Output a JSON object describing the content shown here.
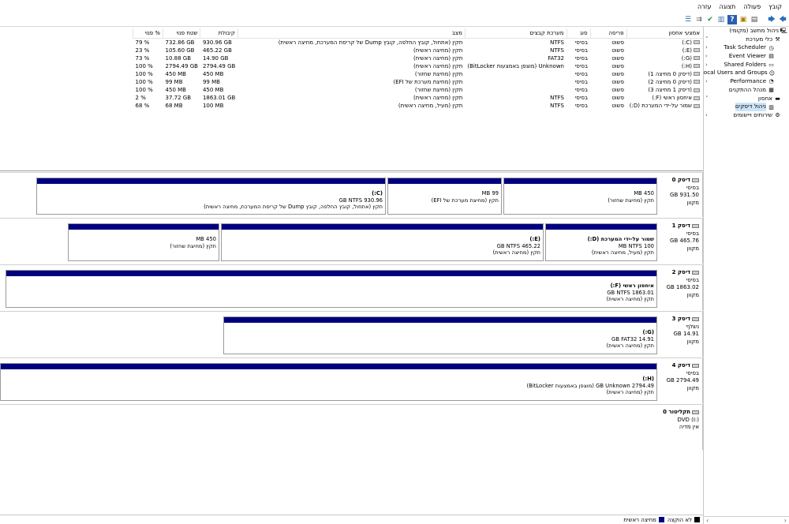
{
  "menu": [
    "קובץ",
    "פעולה",
    "תצוגה",
    "עזרה"
  ],
  "tree": [
    {
      "label": "ניהול מחשב (מקומי)",
      "icon": "computer-icon",
      "indent": 0,
      "chev": ""
    },
    {
      "label": "כלי מערכת",
      "icon": "tools-icon",
      "indent": 1,
      "chev": "˅"
    },
    {
      "label": "Task Scheduler",
      "icon": "clock-icon",
      "indent": 2,
      "chev": "‹"
    },
    {
      "label": "Event Viewer",
      "icon": "event-viewer-icon",
      "indent": 2,
      "chev": "‹"
    },
    {
      "label": "Shared Folders",
      "icon": "folder-icon",
      "indent": 2,
      "chev": "‹"
    },
    {
      "label": "Local Users and Groups",
      "icon": "users-icon",
      "indent": 2,
      "chev": "‹"
    },
    {
      "label": "Performance",
      "icon": "performance-icon",
      "indent": 2,
      "chev": "‹"
    },
    {
      "label": "מנהל ההתקנים",
      "icon": "device-manager-icon",
      "indent": 2,
      "chev": ""
    },
    {
      "label": "אחסון",
      "icon": "storage-icon",
      "indent": 1,
      "chev": "˅"
    },
    {
      "label": "ניהול דיסקים",
      "icon": "disk-management-icon",
      "indent": 2,
      "chev": "",
      "selected": true
    },
    {
      "label": "שירותים ויישומים",
      "icon": "services-icon",
      "indent": 1,
      "chev": "‹"
    }
  ],
  "columns": [
    "אמצעי אחסון",
    "פריסה",
    "סוג",
    "מערכת קבצים",
    "מצב",
    "קיבולת",
    "שטח פנוי",
    "% פנוי"
  ],
  "volumes": [
    {
      "name": "(C:)",
      "layout": "פשוט",
      "type": "בסיסי",
      "fs": "NTFS",
      "status": "תקין (אתחול, קובץ החלפה, קובץ Dump של קריסת המערכת, מחיצה ראשית)",
      "cap": "930.96 GB",
      "free": "732.86 GB",
      "pct": "79 %"
    },
    {
      "name": "(E:)",
      "layout": "פשוט",
      "type": "בסיסי",
      "fs": "NTFS",
      "status": "תקין (מחיצה ראשית)",
      "cap": "465.22 GB",
      "free": "105.60 GB",
      "pct": "23 %"
    },
    {
      "name": "(G:)",
      "layout": "פשוט",
      "type": "בסיסי",
      "fs": "FAT32",
      "status": "תקין (מחיצה ראשית)",
      "cap": "14.90 GB",
      "free": "10.88 GB",
      "pct": "73 %"
    },
    {
      "name": "(H:)",
      "layout": "פשוט",
      "type": "בסיסי",
      "fs": "Unknown (מוצפן באמצעות BitLocker)",
      "status": "תקין (מחיצה ראשית)",
      "cap": "2794.49 GB",
      "free": "2794.49 GB",
      "pct": "100 %"
    },
    {
      "name": "(דיסק 0 מחיצה 1)",
      "layout": "פשוט",
      "type": "בסיסי",
      "fs": "",
      "status": "תקין (מחיצת שחזור)",
      "cap": "450 MB",
      "free": "450 MB",
      "pct": "100 %"
    },
    {
      "name": "(דיסק 0 מחיצה 2)",
      "layout": "פשוט",
      "type": "בסיסי",
      "fs": "",
      "status": "תקין (מחיצת מערכת של EFI)",
      "cap": "99 MB",
      "free": "99 MB",
      "pct": "100 %"
    },
    {
      "name": "(דיסק 1 מחיצה 3)",
      "layout": "פשוט",
      "type": "בסיסי",
      "fs": "",
      "status": "תקין (מחיצת שחזור)",
      "cap": "450 MB",
      "free": "450 MB",
      "pct": "100 %"
    },
    {
      "name": "איחסון ראשי (F:)",
      "layout": "פשוט",
      "type": "בסיסי",
      "fs": "NTFS",
      "status": "תקין (מחיצה ראשית)",
      "cap": "1863.01 GB",
      "free": "37.72 GB",
      "pct": "2 %"
    },
    {
      "name": "שמור על-ידי המערכת (D:)",
      "layout": "פשוט",
      "type": "בסיסי",
      "fs": "NTFS",
      "status": "תקין (מעיל, מחיצה ראשית)",
      "cap": "100 MB",
      "free": "68 MB",
      "pct": "68 %"
    }
  ],
  "disks": [
    {
      "name": "דיסק 0",
      "type": "בסיסי",
      "size": "931.50 GB",
      "state": "מקוון",
      "parts": [
        {
          "title": "",
          "size": "450 MB",
          "status": "תקין (מחיצת שחזור)"
        },
        {
          "title": "",
          "size": "99 MB",
          "status": "תקין (מחיצת מערכת של EFI)"
        },
        {
          "title": "(C:)",
          "size": "930.96 GB NTFS",
          "status": "תקין (אתחול, קובץ החלפה, קובץ Dump של קריסת המערכת, מחיצה ראשית)"
        }
      ]
    },
    {
      "name": "דיסק 1",
      "type": "בסיסי",
      "size": "465.76 GB",
      "state": "מקוון",
      "parts": [
        {
          "title": "שמור על-ידי המערכת (D:)",
          "size": "100 MB NTFS",
          "status": "תקין (מעיל, מחיצה ראשית)"
        },
        {
          "title": "(E:)",
          "size": "465.22 GB NTFS",
          "status": "תקין (מחיצה ראשית)"
        },
        {
          "title": "",
          "size": "450 MB",
          "status": "תקין (מחיצת שחזור)"
        }
      ]
    },
    {
      "name": "דיסק 2",
      "type": "בסיסי",
      "size": "1863.02 GB",
      "state": "מקוון",
      "parts": [
        {
          "title": "איחסון ראשי (F:)",
          "size": "1863.01 GB NTFS",
          "status": "תקין (מחיצה ראשית)"
        }
      ]
    },
    {
      "name": "דיסק 3",
      "type": "נשלף",
      "size": "14.91 GB",
      "state": "מקוון",
      "parts": [
        {
          "title": "(G:)",
          "size": "14.91 GB FAT32",
          "status": "תקין (מחיצה ראשית)"
        }
      ]
    },
    {
      "name": "דיסק 4",
      "type": "בסיסי",
      "size": "2794.49 GB",
      "state": "מקוון",
      "parts": [
        {
          "title": "(H:)",
          "size": "2794.49 GB Unknown (מוצפן באמצעות BitLocker)",
          "status": "תקין (מחיצה ראשית)"
        }
      ]
    },
    {
      "name": "תקליטור 0",
      "type": "DVD (I:)",
      "size": "",
      "state": "אין מדיה",
      "parts": []
    }
  ],
  "legend": [
    {
      "label": "לא הוקצה",
      "color": "#000000"
    },
    {
      "label": "מחיצה ראשית",
      "color": "#00007f"
    }
  ]
}
